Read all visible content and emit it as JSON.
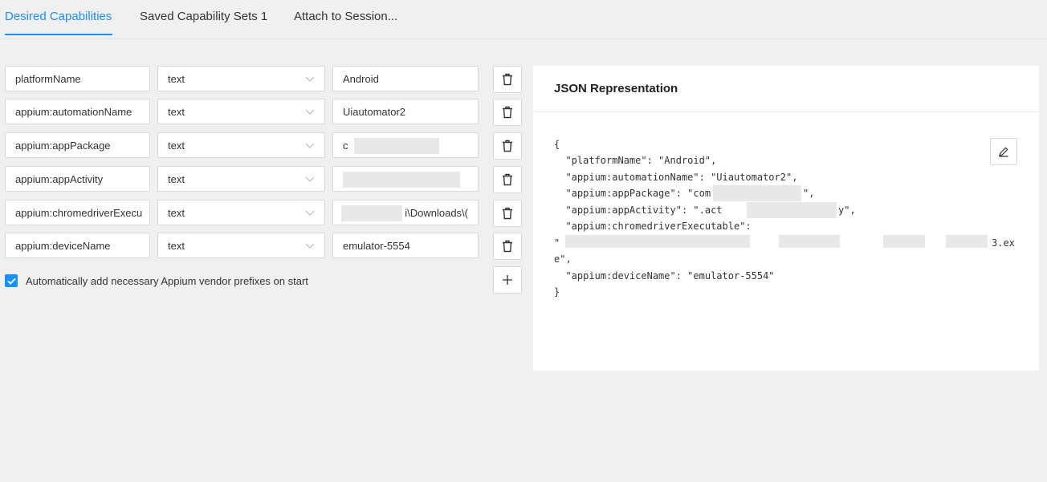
{
  "tabs": [
    {
      "label": "Desired Capabilities",
      "active": true
    },
    {
      "label": "Saved Capability Sets 1",
      "active": false
    },
    {
      "label": "Attach to Session...",
      "active": false
    }
  ],
  "capabilities": [
    {
      "name": "platformName",
      "type": "text",
      "value": "Android"
    },
    {
      "name": "appium:automationName",
      "type": "text",
      "value": "Uiautomator2"
    },
    {
      "name": "appium:appPackage",
      "type": "text",
      "value": "c"
    },
    {
      "name": "appium:appActivity",
      "type": "text",
      "value": ""
    },
    {
      "name": "appium:chromedriverExecu",
      "type": "text",
      "value": "i\\Downloads\\("
    },
    {
      "name": "appium:deviceName",
      "type": "text",
      "value": "emulator-5554"
    }
  ],
  "auto_prefix": {
    "label": "Automatically add necessary Appium vendor prefixes on start",
    "checked": true
  },
  "json_panel": {
    "title": "JSON Representation",
    "lines": [
      "{",
      "  \"platformName\": \"Android\",",
      "  \"appium:automationName\": \"Uiautomator2\",",
      "  \"appium:appPackage\": \"com",
      "  \"appium:appActivity\": \".act",
      "  \"appium:chromedriverExecutable\":",
      "\"",
      "e\",",
      "  \"appium:deviceName\": \"emulator-5554\"",
      "}"
    ],
    "line_tails": {
      "package_tail": "\",",
      "activity_tail": "y\",",
      "exe_tail": "3.ex"
    }
  },
  "icons": {
    "delete": "trash-icon",
    "add": "plus-icon",
    "edit": "pencil-icon",
    "dropdown": "chevron-down-icon",
    "check": "check-icon"
  },
  "colors": {
    "accent": "#1890ff"
  }
}
